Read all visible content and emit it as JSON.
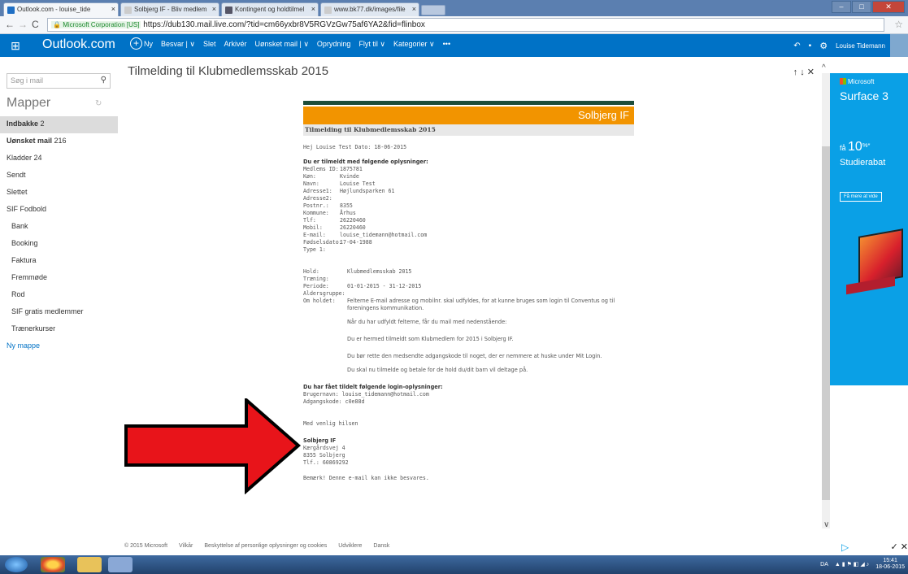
{
  "browser": {
    "tabs": [
      {
        "label": "Outlook.com - louise_tide",
        "icon": "outlook-icon"
      },
      {
        "label": "Solbjerg IF - Bliv medlem",
        "icon": "page-icon"
      },
      {
        "label": "Kontingent og holdtilmel",
        "icon": "page-icon"
      },
      {
        "label": "www.bk77.dk/images/file",
        "icon": "page-icon"
      }
    ],
    "ssl_label": "Microsoft Corporation [US]",
    "url": "https://dub130.mail.live.com/?tid=cm66yxbr8V5RGVzGw75af6YA2&fid=flinbox"
  },
  "header": {
    "brand": "Outlook.com",
    "commands": [
      "Ny",
      "Besvar | ∨",
      "Slet",
      "Arkivér",
      "Uønsket mail | ∨",
      "Oprydning",
      "Flyt til ∨",
      "Kategorier ∨",
      "•••"
    ],
    "user": "Louise Tidemann"
  },
  "sidebar": {
    "search_placeholder": "Søg i mail",
    "heading": "Mapper",
    "folders": [
      {
        "label": "Indbakke",
        "count": "2"
      },
      {
        "label": "Uønsket mail",
        "count": "216"
      },
      {
        "label": "Kladder",
        "count": "24"
      },
      {
        "label": "Sendt",
        "count": ""
      },
      {
        "label": "Slettet",
        "count": ""
      },
      {
        "label": "SIF Fodbold",
        "count": ""
      },
      {
        "label": "Bank",
        "count": ""
      },
      {
        "label": "Booking",
        "count": ""
      },
      {
        "label": "Faktura",
        "count": ""
      },
      {
        "label": "Fremmøde",
        "count": ""
      },
      {
        "label": "Rod",
        "count": ""
      },
      {
        "label": "SIF gratis medlemmer",
        "count": ""
      },
      {
        "label": "Trænerkurser",
        "count": ""
      }
    ],
    "new_folder": "Ny mappe"
  },
  "message": {
    "subject": "Tilmelding til Klubmedlemsskab 2015",
    "banner": "Solbjerg IF",
    "title": "Tilmelding til Klubmedlemsskab 2015",
    "greeting": "Hej Louise Test Dato: 18-06-2015",
    "registered_heading": "Du er tilmeldt med følgende oplysninger:",
    "fields": [
      [
        "Medlems ID:",
        "1875781"
      ],
      [
        "Køn:",
        "Kvinde"
      ],
      [
        "Navn:",
        "Louise Test"
      ],
      [
        "Adresse1:",
        "Højlundsparken 61"
      ],
      [
        "Adresse2:",
        ""
      ],
      [
        "Postnr.:",
        "8355"
      ],
      [
        "Kommune:",
        "Århus"
      ],
      [
        "Tlf:",
        "26220460"
      ],
      [
        "Mobil:",
        "26220460"
      ],
      [
        "E-mail:",
        "louise_tidemann@hotmail.com"
      ],
      [
        "Fødselsdato:",
        "17-04-1988"
      ],
      [
        "Type 1:",
        ""
      ]
    ],
    "team_fields": [
      [
        "Hold:",
        "Klubmedlemsskab 2015"
      ],
      [
        "Træning:",
        ""
      ],
      [
        "Periode:",
        "01-01-2015 - 31-12-2015"
      ],
      [
        "Aldersgruppe:",
        ""
      ]
    ],
    "about_label": "Om holdet:",
    "about_text": "Felterne E-mail adresse og mobilnr. skal udfyldes, for at kunne bruges som login til Conventus og til foreningens kommunikation.",
    "about_p2": "Når du har udfyldt felterne, får du mail med nedenstående:",
    "about_p3": "Du er hermed tilmeldt som Klubmedlem for 2015 i Solbjerg IF.",
    "about_p4": "Du bør rette den medsendte adgangskode til noget, der er nemmere at huske under Mit Login.",
    "about_p5": "Du skal nu tilmelde og betale for de hold du/dit barn vil deltage på.",
    "login_heading": "Du har fået tildelt følgende login-oplysninger:",
    "username": "Brugernavn: louise_tidemann@hotmail.com",
    "password": "Adgangskode: c0e88d",
    "closing": "Med venlig hilsen",
    "sender_name": "Solbjerg IF",
    "sender_address": "Kærgårdsvej 4",
    "sender_city": "8355 Solbjerg",
    "sender_phone": "Tlf.: 60869292",
    "note": "Bemærk! Denne e-mail kan ikke besvares."
  },
  "ad": {
    "brand": "Microsoft",
    "product": "Surface 3",
    "discount_prefix": "få",
    "discount": "10",
    "discount_suffix": "%*",
    "discount_label": "Studierabat",
    "cta": "Få mere at vide"
  },
  "footer": {
    "links": [
      "© 2015 Microsoft",
      "Vilkår",
      "Beskyttelse af personlige oplysninger og cookies",
      "Udviklere",
      "Dansk"
    ]
  },
  "taskbar": {
    "lang": "DA",
    "time": "15:41",
    "date": "18-06-2015"
  },
  "colors": {
    "outlook_blue": "#0072c6",
    "banner_orange": "#f29400",
    "arrow_red": "#e8141a"
  }
}
